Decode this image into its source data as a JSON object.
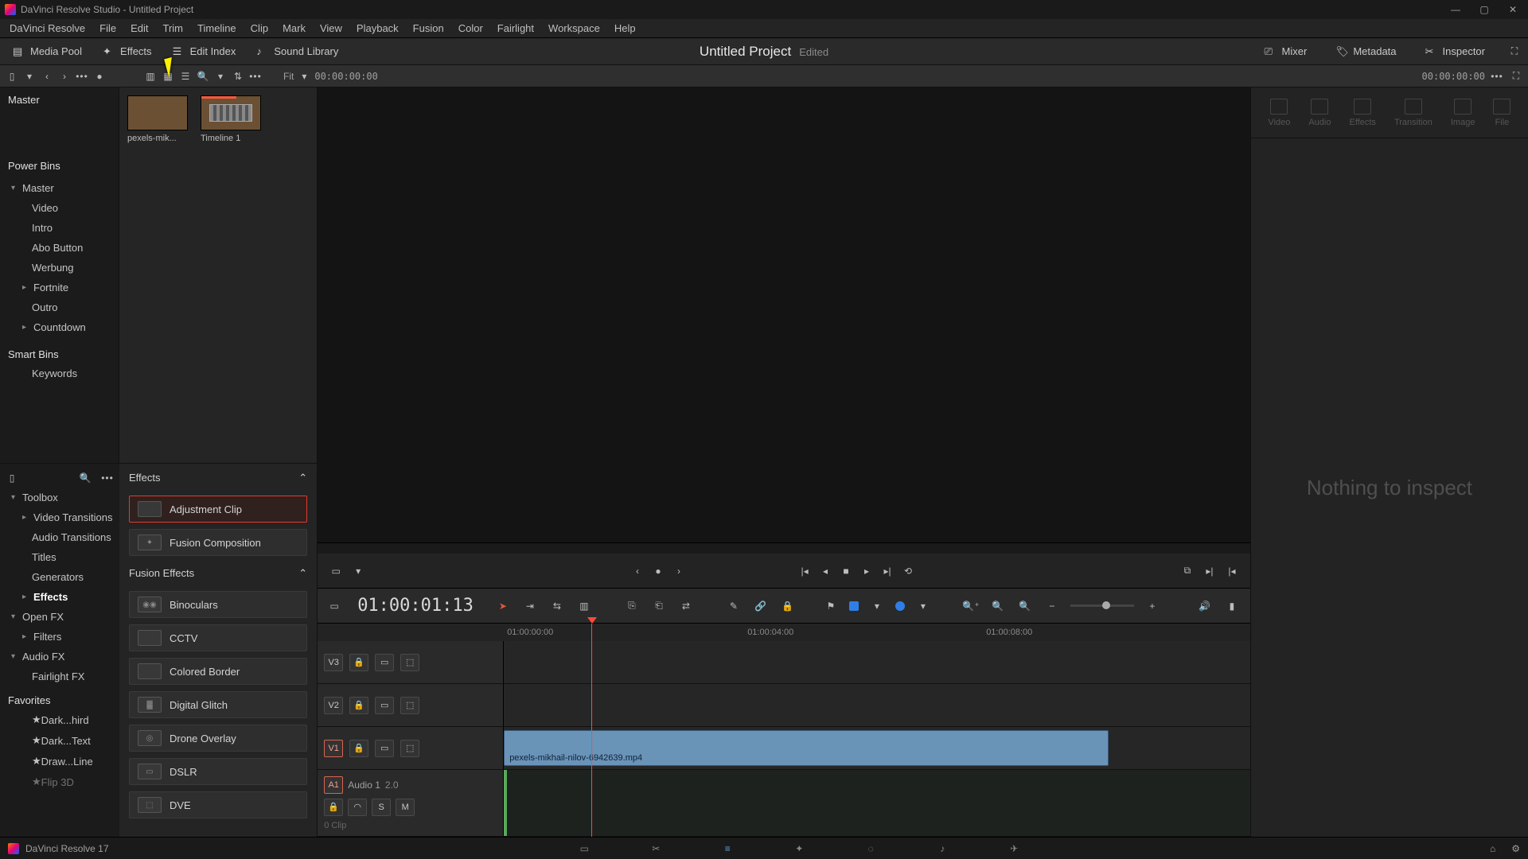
{
  "app": {
    "title": "DaVinci Resolve Studio - Untitled Project",
    "product": "DaVinci Resolve 17"
  },
  "menu": [
    "DaVinci Resolve",
    "File",
    "Edit",
    "Trim",
    "Timeline",
    "Clip",
    "Mark",
    "View",
    "Playback",
    "Fusion",
    "Color",
    "Fairlight",
    "Workspace",
    "Help"
  ],
  "toolbar": {
    "media_pool": "Media Pool",
    "effects": "Effects",
    "edit_index": "Edit Index",
    "sound_library": "Sound Library",
    "project_title": "Untitled Project",
    "project_status": "Edited",
    "mixer": "Mixer",
    "metadata": "Metadata",
    "inspector": "Inspector"
  },
  "secbar": {
    "fit": "Fit",
    "src_tc": "00:00:00:00",
    "rec_tc": "00:00:00:00"
  },
  "bins": {
    "master": "Master",
    "power_bins": "Power Bins",
    "items": [
      {
        "label": "Master",
        "expanded": true
      },
      {
        "label": "Video",
        "child": true
      },
      {
        "label": "Intro",
        "child": true
      },
      {
        "label": "Abo Button",
        "child": true
      },
      {
        "label": "Werbung",
        "child": true
      },
      {
        "label": "Fortnite",
        "expandable": true
      },
      {
        "label": "Outro",
        "child": true
      },
      {
        "label": "Countdown",
        "expandable": true
      }
    ],
    "smart_bins": "Smart Bins",
    "keywords": "Keywords"
  },
  "clips": [
    {
      "label": "pexels-mik...",
      "kind": "video"
    },
    {
      "label": "Timeline 1",
      "kind": "timeline"
    }
  ],
  "fx_tree": [
    {
      "label": "Toolbox",
      "exp": true
    },
    {
      "label": "Video Transitions",
      "child": true,
      "expandable": true
    },
    {
      "label": "Audio Transitions",
      "child": true
    },
    {
      "label": "Titles",
      "child": true
    },
    {
      "label": "Generators",
      "child": true
    },
    {
      "label": "Effects",
      "child": true,
      "selected": true,
      "expandable": true
    },
    {
      "label": "Open FX",
      "exp": true
    },
    {
      "label": "Filters",
      "child": true,
      "expandable": true
    },
    {
      "label": "Audio FX",
      "exp": true
    },
    {
      "label": "Fairlight FX",
      "child": true
    }
  ],
  "fx_favorites_title": "Favorites",
  "fx_favorites": [
    "Dark...hird",
    "Dark...Text",
    "Draw...Line",
    "Flip 3D"
  ],
  "fx_list": {
    "effects_title": "Effects",
    "effects": [
      "Adjustment Clip",
      "Fusion Composition"
    ],
    "fusion_title": "Fusion Effects",
    "fusion": [
      "Binoculars",
      "CCTV",
      "Colored Border",
      "Digital Glitch",
      "Drone Overlay",
      "DSLR",
      "DVE"
    ]
  },
  "timeline": {
    "timecode": "01:00:01:13",
    "ruler": [
      "01:00:00:00",
      "01:00:04:00",
      "01:00:08:00"
    ],
    "tracks": {
      "v3": "V3",
      "v2": "V2",
      "v1": "V1",
      "a1_tag": "A1",
      "a1_name": "Audio 1",
      "a1_ch": "2.0",
      "a1_meta": "0 Clip",
      "btn_s": "S",
      "btn_m": "M"
    },
    "clip_name": "pexels-mikhail-nilov-6942639.mp4"
  },
  "inspector": {
    "tabs": [
      "Video",
      "Audio",
      "Effects",
      "Transition",
      "Image",
      "File"
    ],
    "empty": "Nothing to inspect"
  }
}
